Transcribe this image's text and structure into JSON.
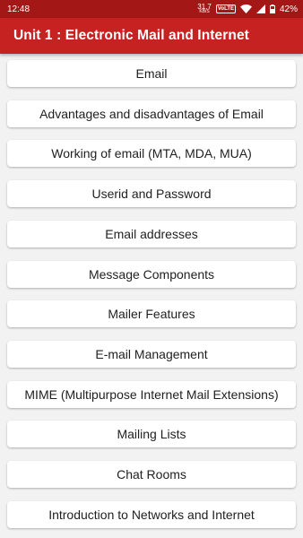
{
  "status_bar": {
    "time": "12:48",
    "net_speed": "31.7",
    "net_speed_unit": "KB/S",
    "volte": "VoLTE",
    "battery": "42%"
  },
  "app_bar": {
    "title": "Unit 1 : Electronic Mail and Internet"
  },
  "topics": [
    "Email",
    "Advantages and disadvantages of Email",
    "Working of email (MTA, MDA, MUA)",
    "Userid and Password",
    "Email addresses",
    "Message Components",
    "Mailer Features",
    "E-mail Management",
    "MIME (Multipurpose Internet Mail Extensions)",
    "Mailing Lists",
    "Chat Rooms",
    "Introduction to Networks and Internet"
  ],
  "colors": {
    "status_bar": "#a31717",
    "app_bar": "#c62222",
    "background": "#f2f2f2",
    "button": "#ffffff"
  }
}
